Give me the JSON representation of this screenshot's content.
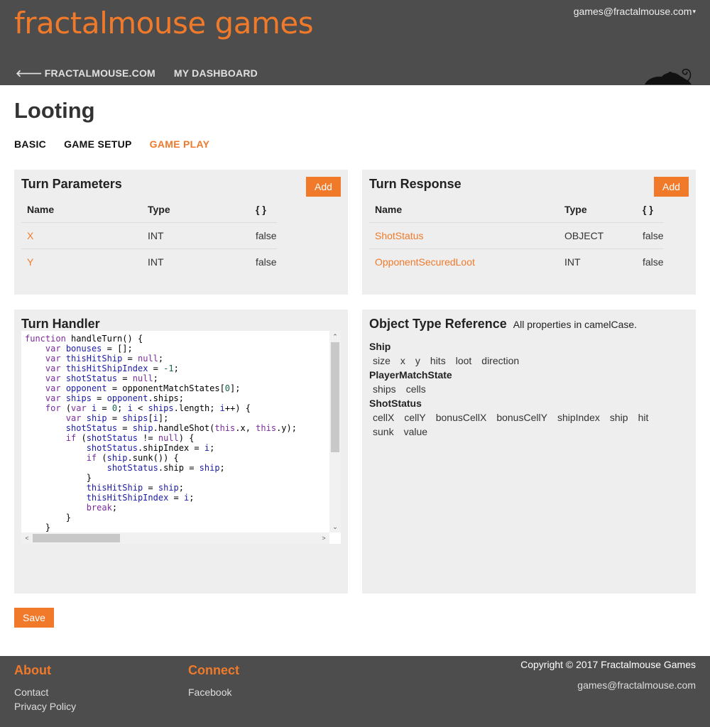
{
  "header": {
    "brand": "fractalmouse games",
    "account_email": "games@fractalmouse.com",
    "account_caret": "▾",
    "nav": {
      "back_label": "FRACTALMOUSE.COM",
      "dashboard_label": "MY DASHBOARD"
    }
  },
  "page": {
    "title": "Looting",
    "tabs": [
      "BASIC",
      "GAME SETUP",
      "GAME PLAY"
    ],
    "active_tab": "GAME PLAY"
  },
  "turn_parameters": {
    "title": "Turn Parameters",
    "add_label": "Add",
    "columns": [
      "Name",
      "Type",
      "{ }"
    ],
    "rows": [
      {
        "name": "X",
        "type": "INT",
        "array": "false"
      },
      {
        "name": "Y",
        "type": "INT",
        "array": "false"
      }
    ]
  },
  "turn_response": {
    "title": "Turn Response",
    "add_label": "Add",
    "columns": [
      "Name",
      "Type",
      "{ }"
    ],
    "rows": [
      {
        "name": "ShotStatus",
        "type": "OBJECT",
        "array": "false"
      },
      {
        "name": "OpponentSecuredLoot",
        "type": "INT",
        "array": "false"
      }
    ]
  },
  "turn_handler": {
    "title": "Turn Handler"
  },
  "object_reference": {
    "title": "Object Type Reference",
    "subtitle": "All properties in camelCase.",
    "types": [
      {
        "name": "Ship",
        "props": [
          "size",
          "x",
          "y",
          "hits",
          "loot",
          "direction"
        ]
      },
      {
        "name": "PlayerMatchState",
        "props": [
          "ships",
          "cells"
        ]
      },
      {
        "name": "ShotStatus",
        "props": [
          "cellX",
          "cellY",
          "bonusCellX",
          "bonusCellY",
          "shipIndex",
          "ship",
          "hit",
          "sunk",
          "value"
        ]
      }
    ]
  },
  "save_label": "Save",
  "footer": {
    "about_title": "About",
    "about_links": [
      "Contact",
      "Privacy Policy"
    ],
    "connect_title": "Connect",
    "connect_links": [
      "Facebook"
    ],
    "copyright": "Copyright © 2017 Fractalmouse Games",
    "email": "games@fractalmouse.com"
  },
  "colors": {
    "accent": "#f07a2a",
    "header_bg": "#4d4d4d",
    "panel_bg": "#eeeeee"
  }
}
